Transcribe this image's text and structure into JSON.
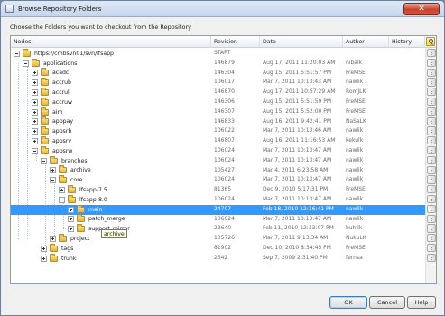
{
  "window": {
    "title": "Browse Repository Folders",
    "close_glyph": "✕"
  },
  "instruction": "Choose the Folders you want to checkout from the Repository",
  "columns": {
    "nodes": "Nodes",
    "revision": "Revision",
    "date": "Date",
    "author": "Author",
    "history": "History"
  },
  "rows": [
    {
      "label": "https://cmbsvn01/svn/lfsapp",
      "revision": "START",
      "date": "",
      "author": "",
      "level": 0,
      "expander": "expanded",
      "selected": false
    },
    {
      "label": "applications",
      "revision": "146879",
      "date": "Aug 17, 2011 11:20:03 AM",
      "author": "nibalk",
      "level": 1,
      "expander": "expanded",
      "selected": false
    },
    {
      "label": "acadc",
      "revision": "146304",
      "date": "Aug 15, 2011 5:51:57 PM",
      "author": "FreMSE",
      "level": 2,
      "expander": "collapsed",
      "selected": false
    },
    {
      "label": "accrub",
      "revision": "106017",
      "date": "Mar 7, 2011 10:13:43 AM",
      "author": "nawlik",
      "level": 2,
      "expander": "collapsed",
      "selected": false
    },
    {
      "label": "accrul",
      "revision": "146870",
      "date": "Aug 17, 2011 10:57:29 AM",
      "author": "RomJLK",
      "level": 2,
      "expander": "collapsed",
      "selected": false
    },
    {
      "label": "accruw",
      "revision": "146306",
      "date": "Aug 15, 2011 5:51:59 PM",
      "author": "FreMSE",
      "level": 2,
      "expander": "collapsed",
      "selected": false
    },
    {
      "label": "aim",
      "revision": "146307",
      "date": "Aug 15, 2011 5:52:00 PM",
      "author": "FreMSE",
      "level": 2,
      "expander": "collapsed",
      "selected": false
    },
    {
      "label": "apppay",
      "revision": "146833",
      "date": "Aug 16, 2011 9:42:41 PM",
      "author": "NaSaLK",
      "level": 2,
      "expander": "collapsed",
      "selected": false
    },
    {
      "label": "appsrb",
      "revision": "106022",
      "date": "Mar 7, 2011 10:13:46 AM",
      "author": "nawlik",
      "level": 2,
      "expander": "collapsed",
      "selected": false
    },
    {
      "label": "appsrv",
      "revision": "146807",
      "date": "Aug 16, 2011 11:16:53 AM",
      "author": "kekulk",
      "level": 2,
      "expander": "collapsed",
      "selected": false
    },
    {
      "label": "appsrw",
      "revision": "106024",
      "date": "Mar 7, 2011 10:13:47 AM",
      "author": "nawlik",
      "level": 2,
      "expander": "expanded",
      "selected": false
    },
    {
      "label": "branches",
      "revision": "106024",
      "date": "Mar 7, 2011 10:13:47 AM",
      "author": "nawlik",
      "level": 3,
      "expander": "expanded",
      "selected": false
    },
    {
      "label": "archive",
      "revision": "105427",
      "date": "Mar 4, 2011 6:23:58 AM",
      "author": "nawlik",
      "level": 4,
      "expander": "collapsed",
      "selected": false
    },
    {
      "label": "core",
      "revision": "106024",
      "date": "Mar 7, 2011 10:13:47 AM",
      "author": "nawlik",
      "level": 4,
      "expander": "expanded",
      "selected": false
    },
    {
      "label": "lfsapp-7.5",
      "revision": "81365",
      "date": "Dec 9, 2010 5:17:31 PM",
      "author": "FreMSE",
      "level": 5,
      "expander": "collapsed",
      "selected": false
    },
    {
      "label": "lfsapp-8.0",
      "revision": "106024",
      "date": "Mar 7, 2011 10:13:47 AM",
      "author": "nawlik",
      "level": 5,
      "expander": "expanded",
      "selected": false
    },
    {
      "label": "main",
      "revision": "24707",
      "date": "Feb 18, 2010 12:16:41 PM",
      "author": "nawlik",
      "level": 6,
      "expander": "collapsed",
      "selected": true
    },
    {
      "label": "patch_merge",
      "revision": "106024",
      "date": "Mar 7, 2011 10:13:47 AM",
      "author": "nawlik",
      "level": 6,
      "expander": "collapsed",
      "selected": false
    },
    {
      "label": "support_mirror",
      "revision": "23640",
      "date": "Feb 11, 2010 12:13:07 PM",
      "author": "buhilk",
      "level": 6,
      "expander": "collapsed",
      "selected": false
    },
    {
      "label": "project",
      "revision": "105726",
      "date": "Mar 7, 2011 9:13:34 AM",
      "author": "NukuLK",
      "level": 4,
      "expander": "collapsed",
      "selected": false
    },
    {
      "label": "tags",
      "revision": "81902",
      "date": "Dec 10, 2010 8:34:45 PM",
      "author": "FreMSE",
      "level": 3,
      "expander": "collapsed",
      "selected": false
    },
    {
      "label": "trunk",
      "revision": "2542",
      "date": "Sep 7, 2009 2:31:40 PM",
      "author": "fernsa",
      "level": 3,
      "expander": "collapsed",
      "selected": false
    }
  ],
  "tooltip": "archive",
  "buttons": {
    "ok": "OK",
    "cancel": "Cancel",
    "help": "Help"
  },
  "icons": {
    "app": "window-icon",
    "folder": "folder-icon",
    "close": "close-icon",
    "select_all": "magnifier-icon"
  },
  "colors": {
    "selection": "#3399ff",
    "close_button": "#c8412b",
    "tooltip_bg": "#ffffe1"
  }
}
